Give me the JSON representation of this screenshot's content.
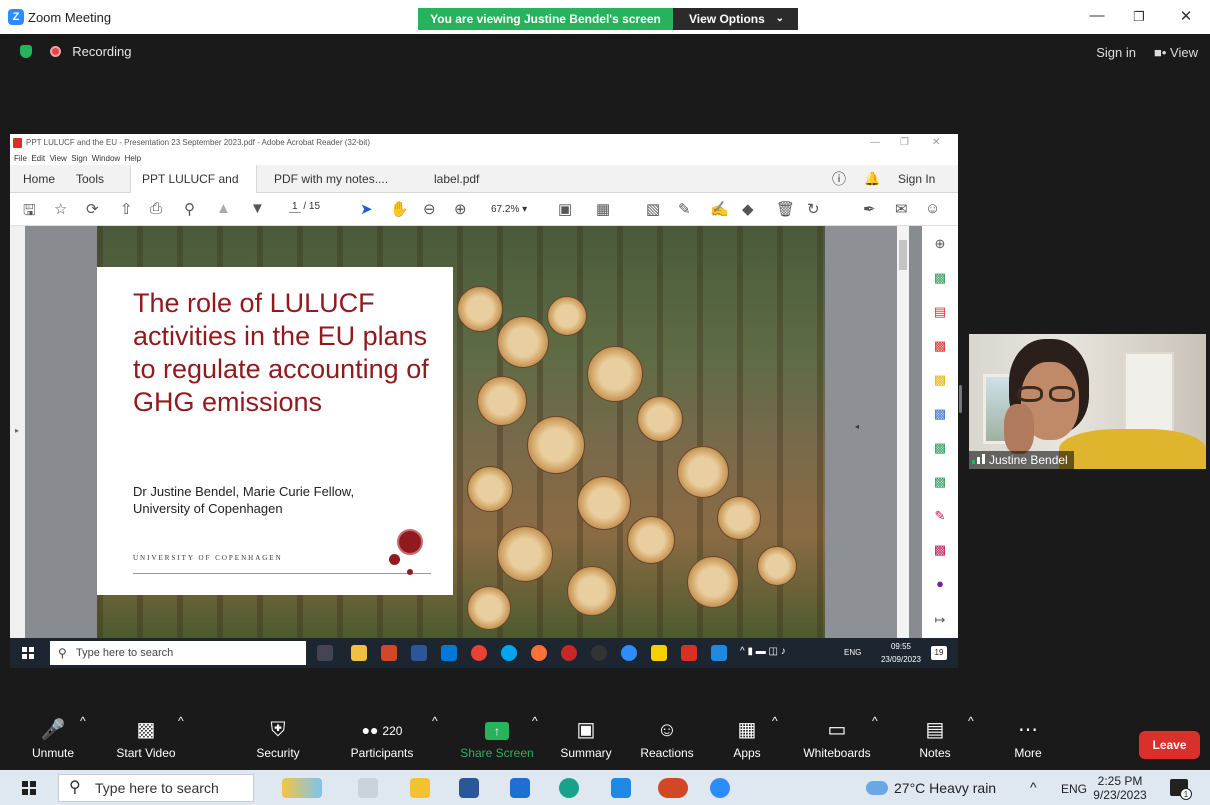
{
  "window": {
    "app_title": "Zoom Meeting",
    "viewing_banner": "You are viewing Justine Bendel's screen",
    "view_options": "View Options"
  },
  "meeting_top": {
    "recording_label": "Recording",
    "sign_in": "Sign in",
    "view_label": "View"
  },
  "shared_screen": {
    "acrobat": {
      "window_title": "PPT LULUCF and the EU - Presentation 23 September 2023.pdf - Adobe Acrobat Reader (32-bit)",
      "menu": [
        "File",
        "Edit",
        "View",
        "Sign",
        "Window",
        "Help"
      ],
      "tabs": {
        "home": "Home",
        "tools": "Tools",
        "doc1": "PPT LULUCF and th...",
        "doc2": "PDF with my notes....",
        "doc3": "label.pdf"
      },
      "sign_in": "Sign In",
      "page_current": "1",
      "page_total": "/ 15",
      "zoom_level": "67.2%"
    },
    "slide": {
      "title": "The role of LULUCF activities in the EU plans to regulate accounting of GHG emissions",
      "author_line1": "Dr Justine Bendel, Marie Curie Fellow,",
      "author_line2": "University of Copenhagen",
      "university": "UNIVERSITY OF COPENHAGEN"
    },
    "inner_taskbar": {
      "search_placeholder": "Type here to search",
      "lang": "ENG",
      "time": "09:55",
      "date": "23/09/2023",
      "notifications": "19"
    }
  },
  "participant_video": {
    "name": "Justine Bendel"
  },
  "zoom_toolbar": {
    "unmute": "Unmute",
    "start_video": "Start Video",
    "security": "Security",
    "participants": "Participants",
    "participants_count": "220",
    "share_screen": "Share Screen",
    "summary": "Summary",
    "reactions": "Reactions",
    "apps": "Apps",
    "whiteboards": "Whiteboards",
    "notes": "Notes",
    "more": "More",
    "leave": "Leave"
  },
  "taskbar": {
    "search_placeholder": "Type here to search",
    "weather": "27°C  Heavy rain",
    "lang": "ENG",
    "time": "2:25 PM",
    "date": "9/23/2023",
    "notifications": "1"
  },
  "colors": {
    "zoom_green": "#27b35b",
    "leave_red": "#d9302c",
    "slide_title_red": "#901a1e",
    "zoom_bg": "#1a1a1a"
  }
}
